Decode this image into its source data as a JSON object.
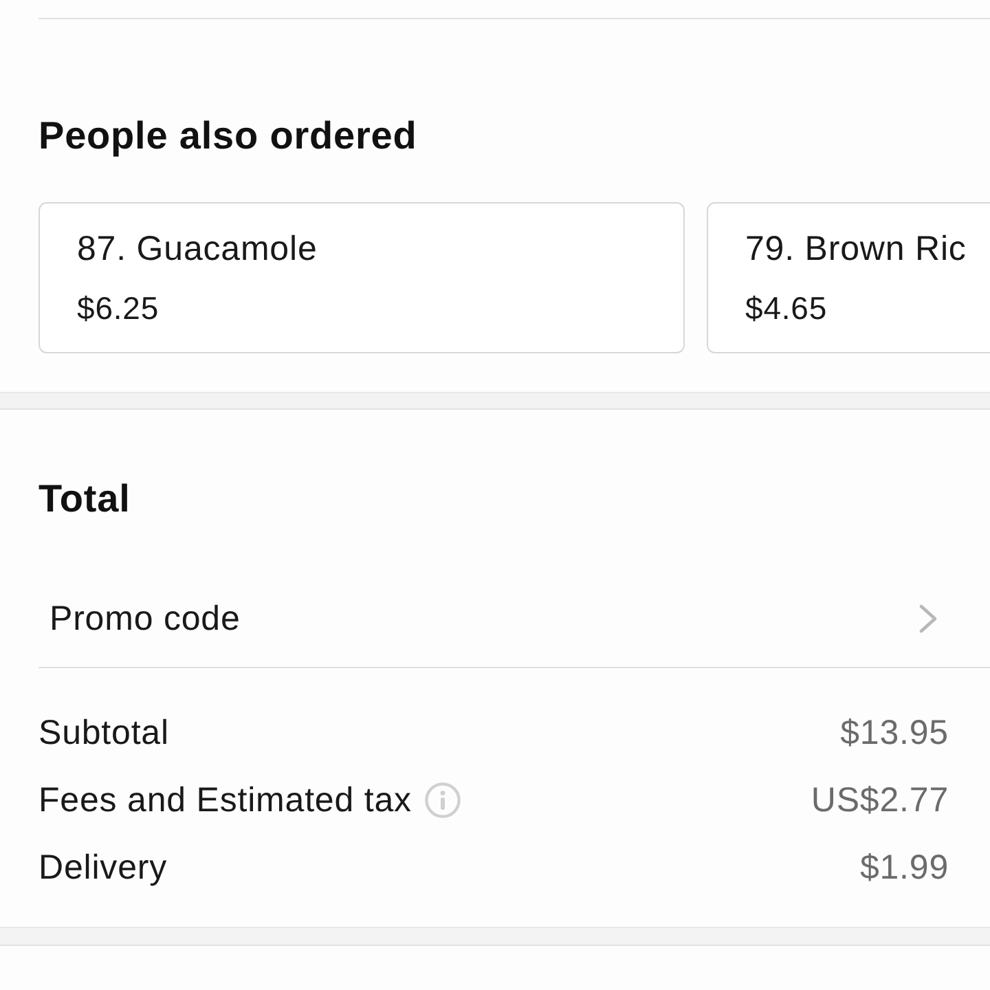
{
  "people_also_ordered": {
    "title": "People also ordered",
    "items": [
      {
        "name": "87. Guacamole",
        "price": "$6.25"
      },
      {
        "name": "79. Brown Ric",
        "price": "$4.65"
      }
    ]
  },
  "total": {
    "title": "Total",
    "promo_code": {
      "label": "Promo code"
    },
    "lines": [
      {
        "label": "Subtotal",
        "value": "$13.95",
        "info": false
      },
      {
        "label": "Fees and Estimated tax",
        "value": "US$2.77",
        "info": true
      },
      {
        "label": "Delivery",
        "value": "$1.99",
        "info": false
      }
    ]
  }
}
